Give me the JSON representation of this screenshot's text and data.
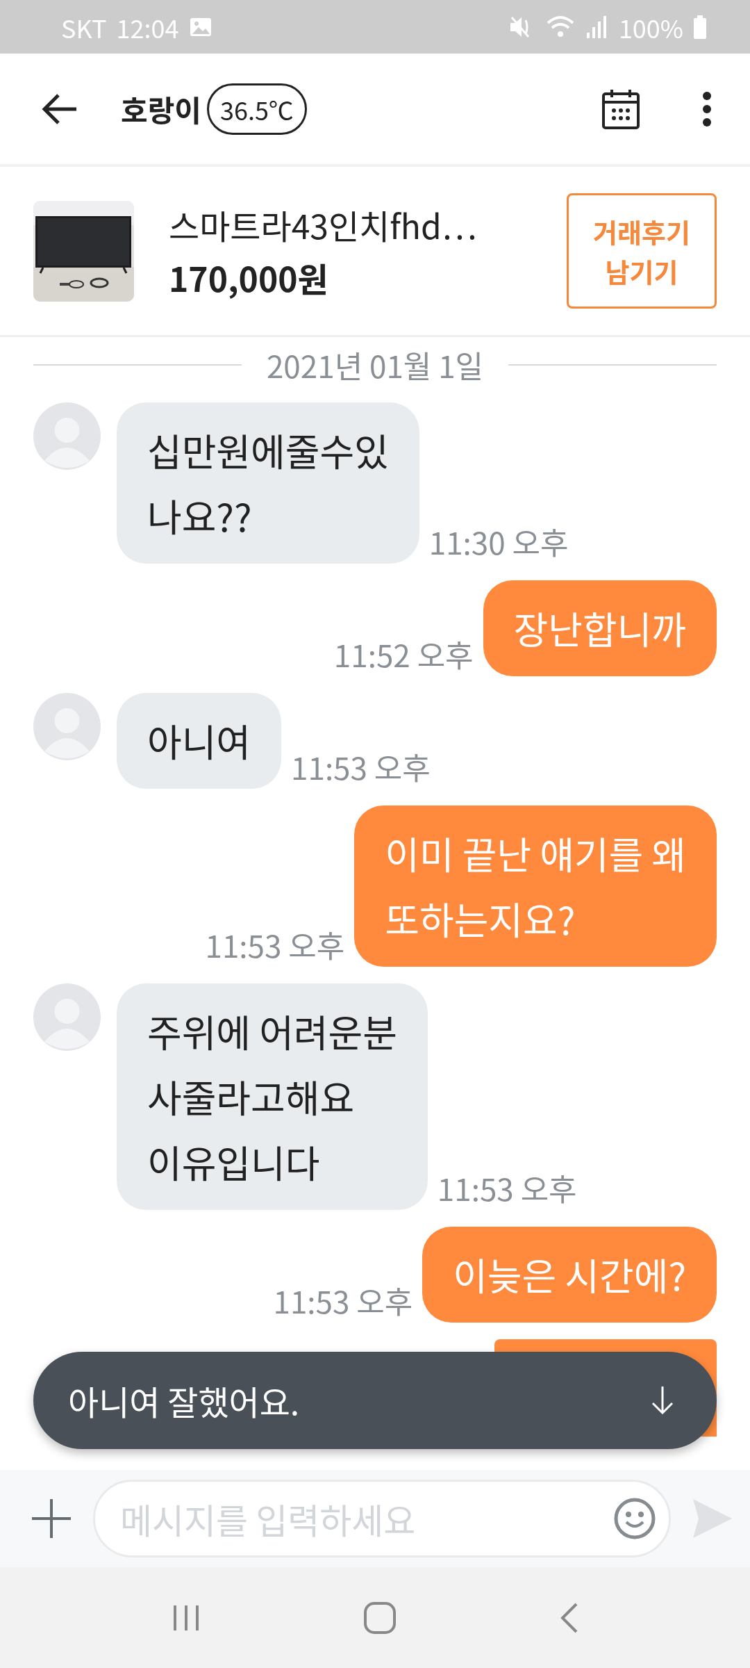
{
  "status_bar": {
    "carrier": "SKT",
    "time": "12:04",
    "battery": "100%"
  },
  "header": {
    "name": "호랑이",
    "temperature": "36.5℃"
  },
  "product": {
    "title": "스마트라43인치fhd…",
    "price": "170,000원",
    "review_button": "거래후기\n남기기"
  },
  "date_divider": "2021년 01월 1일",
  "messages": [
    {
      "kind": "received",
      "text": "십만원에줄수있\n나요??",
      "time": "11:30 오후"
    },
    {
      "kind": "sent",
      "text": "장난합니까",
      "time": "11:52 오후"
    },
    {
      "kind": "received",
      "text": "아니여",
      "time": "11:53 오후"
    },
    {
      "kind": "sent",
      "text": "이미 끝난 얘기를 왜\n또하는지요?",
      "time": "11:53 오후"
    },
    {
      "kind": "received",
      "text": "주위에 어려운분\n사줄라고해요\n이유입니다",
      "time": "11:53 오후"
    },
    {
      "kind": "sent",
      "text": "이늦은 시간에?",
      "time": "11:53 오후"
    }
  ],
  "covered_message": {
    "kind": "sent"
  },
  "toast": {
    "text": "아니여 잘했어요."
  },
  "composer": {
    "placeholder": "메시지를 입력하세요"
  }
}
